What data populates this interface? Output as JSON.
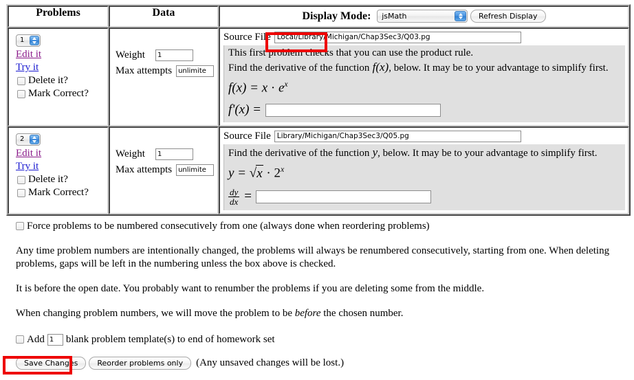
{
  "table": {
    "headers": {
      "problems": "Problems",
      "data": "Data",
      "display_mode_label": "Display Mode:",
      "display_mode_value": "jsMath",
      "refresh_button": "Refresh Display"
    },
    "row_labels": {
      "edit": "Edit it",
      "try": "Try it",
      "delete": "Delete it?",
      "mark_correct": "Mark Correct?",
      "weight": "Weight",
      "max_attempts": "Max attempts",
      "source_file": "Source File"
    },
    "rows": [
      {
        "number": "1",
        "weight": "1",
        "max_attempts": "unlimite",
        "source_file": "Local/Library/Michigan/Chap3Sec3/Q03.pg",
        "intro_line": "This first problem checks that you can use the product rule.",
        "prompt": "Find the derivative of the function f(x), below. It may be to your advantage to simplify first.",
        "prompt_pre": "Find the derivative of the function",
        "prompt_var": "f(x)",
        "prompt_post": ", below. It may be to your advantage to simplify first.",
        "equation": "f(x) = x · e^x",
        "answer_label": "f'(x) =",
        "answer_value": ""
      },
      {
        "number": "2",
        "weight": "1",
        "max_attempts": "unlimite",
        "source_file": "Library/Michigan/Chap3Sec3/Q05.pg",
        "intro_line": "",
        "prompt": "Find the derivative of the function y, below. It may be to your advantage to simplify first.",
        "prompt_pre": "Find the derivative of the function",
        "prompt_var": "y",
        "prompt_post": ", below. It may be to your advantage to simplify first.",
        "equation": "y = √x · 2^x",
        "answer_label_num": "dy",
        "answer_label_den": "dx",
        "answer_label_eq": "=",
        "answer_value": ""
      }
    ]
  },
  "options": {
    "force_renumber_label": "Force problems to be numbered consecutively from one (always done when reordering problems)",
    "paragraph_1": "Any time problem numbers are intentionally changed, the problems will always be renumbered consecutively, starting from one. When deleting problems, gaps will be left in the numbering unless the box above is checked.",
    "paragraph_2": "It is before the open date. You probably want to renumber the problems if you are deleting some from the middle.",
    "paragraph_3_pre": "When changing problem numbers, we will move the problem to be ",
    "paragraph_3_em": "before",
    "paragraph_3_post": " the chosen number.",
    "add_prefix": "Add",
    "add_count": "1",
    "add_suffix": "blank problem template(s) to end of homework set"
  },
  "actions": {
    "save_changes": "Save Changes",
    "reorder_only": "Reorder problems only",
    "note": "(Any unsaved changes will be lost.)"
  },
  "colors": {
    "annotation_red": "#ee0000",
    "problem_body_gray": "#e0e0e0",
    "visited_link": "#8a1a8a",
    "link": "#1a1ad0"
  },
  "icons": {
    "stepper": "updown-stepper-icon",
    "select_arrows": "select-updown-arrows-icon"
  }
}
